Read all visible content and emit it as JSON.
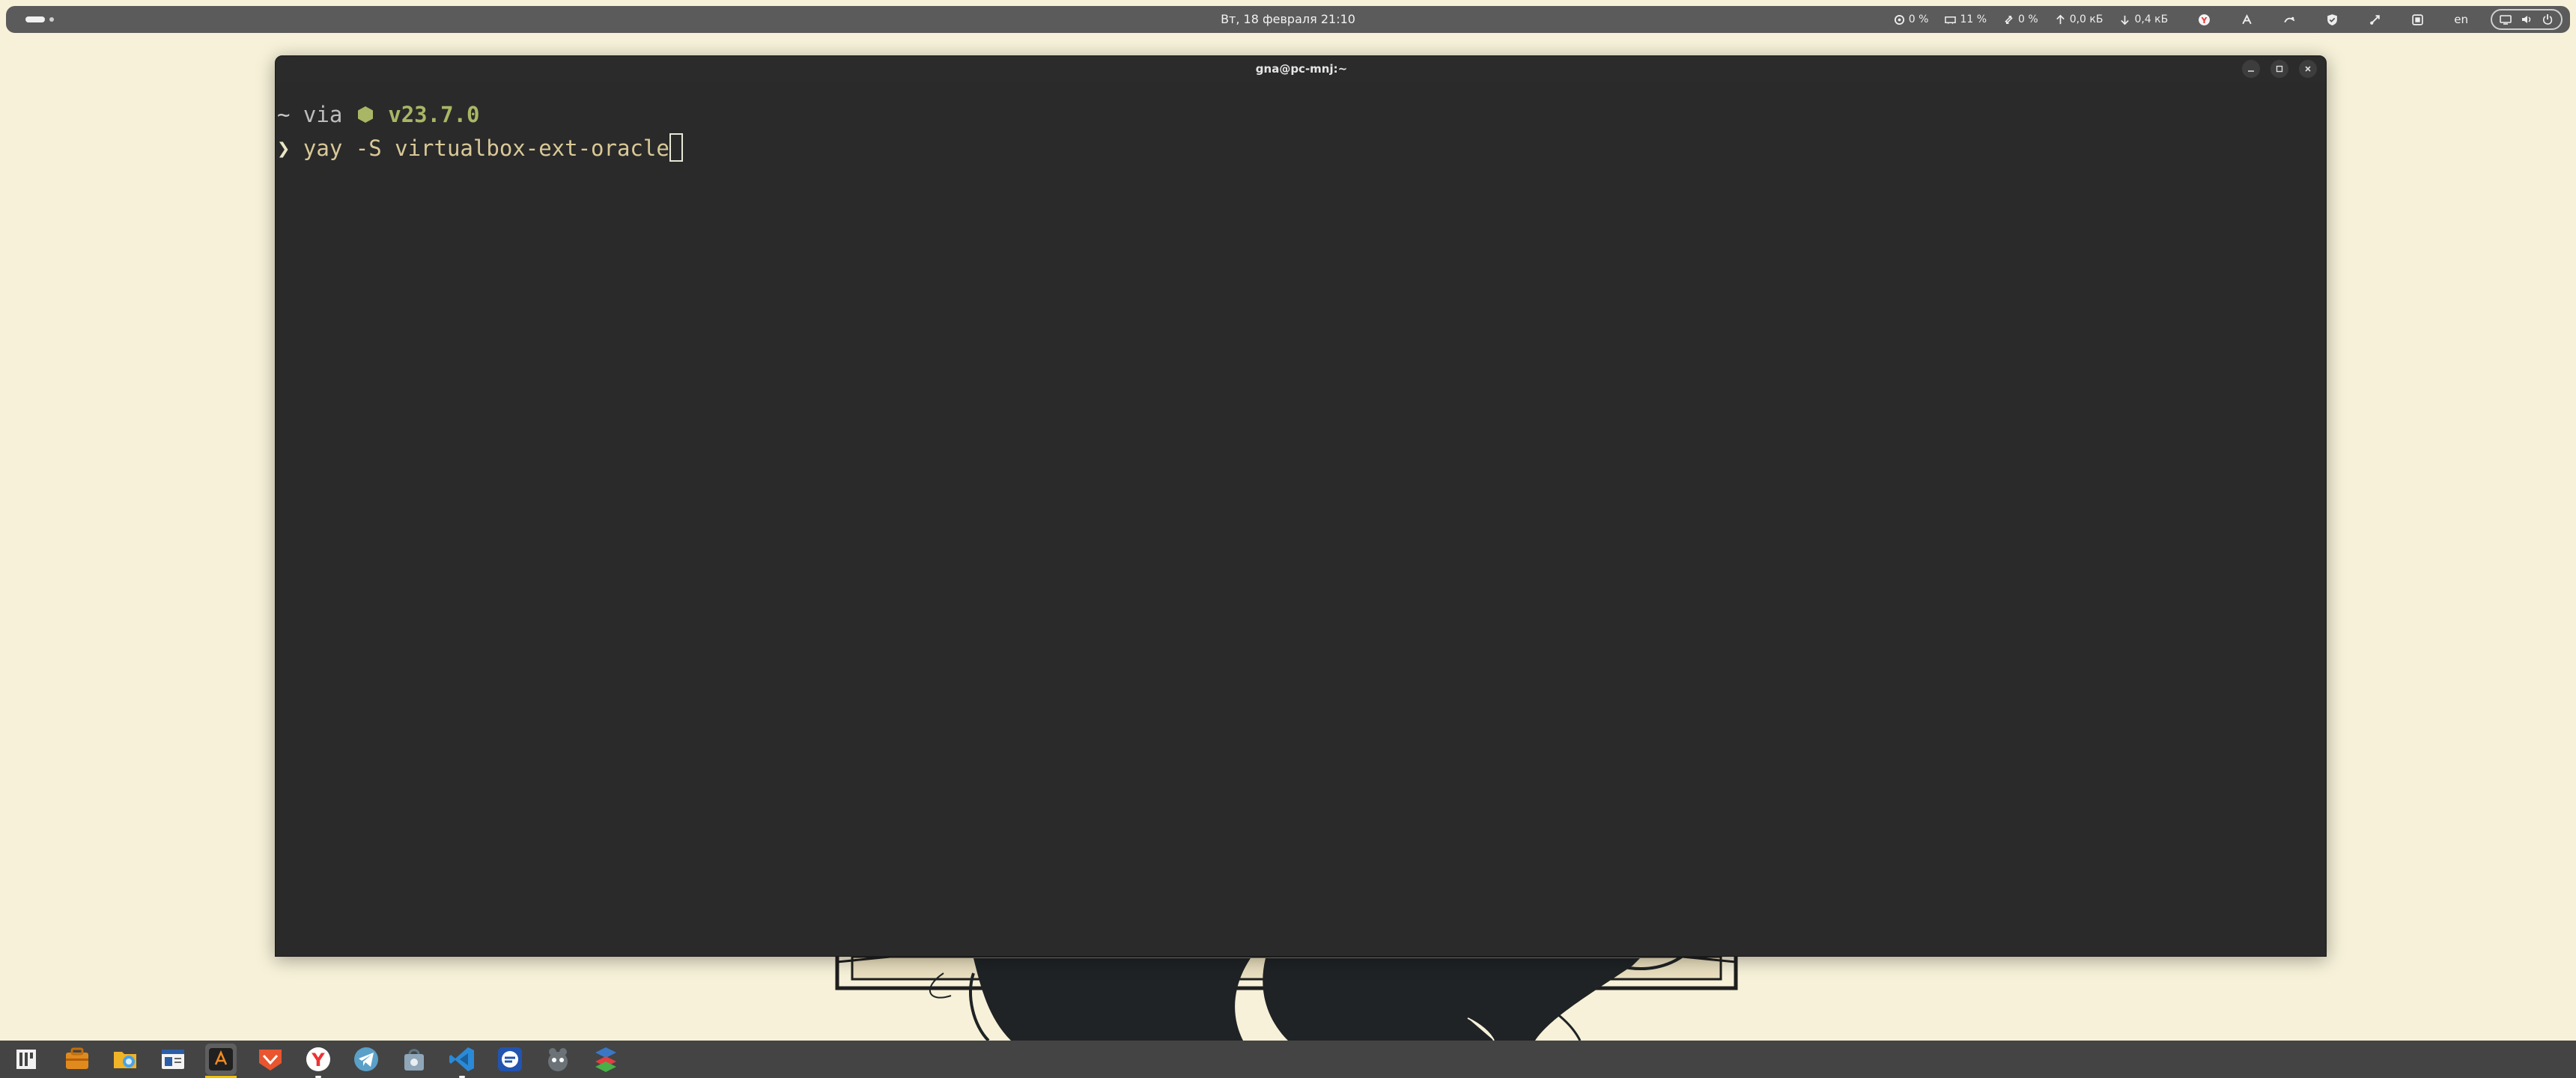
{
  "topbar": {
    "datetime": "Вт, 18 февраля  21:10",
    "indicators": {
      "cpu": "0 %",
      "memory": "11 %",
      "swap": "0 %",
      "net_up": "0,0 кБ",
      "net_down": "0,4 кБ"
    },
    "language": "en",
    "icons": [
      "yandex-browser-tray-icon",
      "tray-app-icon",
      "tray-app-icon-2",
      "shield-tray-icon",
      "tray-app-icon-3",
      "tray-app-icon-4"
    ]
  },
  "terminal": {
    "title": "gna@pc-mnj:~",
    "line1": {
      "dir": "~",
      "via": " via ",
      "node_version": "v23.7.0"
    },
    "line2": {
      "prompt": "❯ ",
      "command": "yay -S virtualbox-ext-oracle"
    }
  },
  "dock": {
    "items": [
      "app-grid-icon",
      "toolbox-icon",
      "file-manager-icon",
      "text-editor-icon",
      "terminal-icon",
      "gitkraken-icon",
      "yandex-browser-icon",
      "telegram-icon",
      "software-icon",
      "vscode-icon",
      "app-blue-icon",
      "gimp-icon",
      "virtualbox-icon"
    ],
    "active_index": 4
  },
  "colors": {
    "desktop_bg": "#f6f1d8",
    "panel": "#5b5b5b",
    "terminal_bg": "#2a2a2a",
    "node_green": "#a9b665",
    "command_yellow": "#d9c998",
    "dock_active_indicator": "#f0c000"
  }
}
